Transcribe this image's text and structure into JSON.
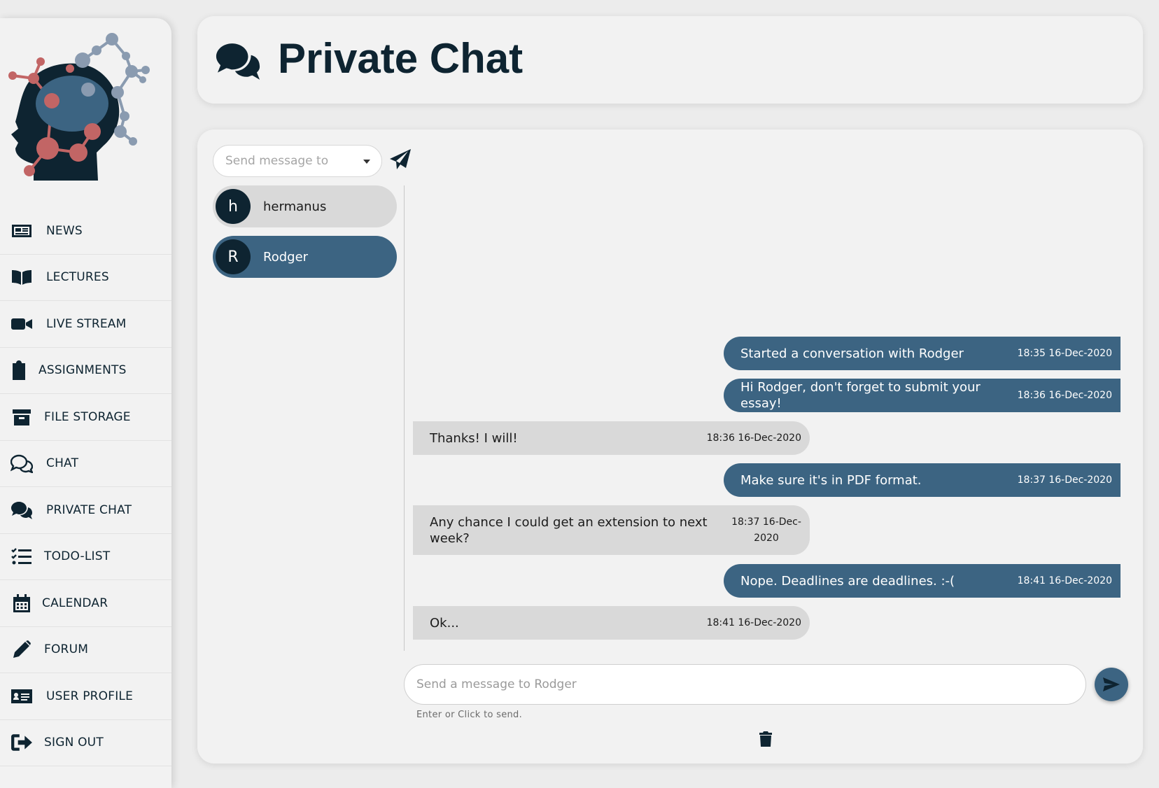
{
  "sidebar": {
    "items": [
      {
        "label": "NEWS",
        "icon": "newspaper-icon"
      },
      {
        "label": "LECTURES",
        "icon": "book-icon"
      },
      {
        "label": "LIVE STREAM",
        "icon": "video-camera-icon"
      },
      {
        "label": "ASSIGNMENTS",
        "icon": "clipboard-icon"
      },
      {
        "label": "FILE STORAGE",
        "icon": "archive-icon"
      },
      {
        "label": "CHAT",
        "icon": "comments-outline-icon"
      },
      {
        "label": "PRIVATE CHAT",
        "icon": "comments-icon"
      },
      {
        "label": "TODO-LIST",
        "icon": "tasks-icon"
      },
      {
        "label": "CALENDAR",
        "icon": "calendar-icon"
      },
      {
        "label": "FORUM",
        "icon": "pencil-icon"
      },
      {
        "label": "USER PROFILE",
        "icon": "id-card-icon"
      },
      {
        "label": "SIGN OUT",
        "icon": "sign-out-icon"
      }
    ]
  },
  "header": {
    "title": "Private Chat"
  },
  "recipient": {
    "placeholder": "Send message to"
  },
  "contacts": [
    {
      "initial": "h",
      "name": "hermanus",
      "active": false
    },
    {
      "initial": "R",
      "name": "Rodger",
      "active": true
    }
  ],
  "messages": [
    {
      "dir": "out",
      "text": "Started a conversation with Rodger",
      "time": "18:35 16-Dec-2020"
    },
    {
      "dir": "out",
      "text": "Hi Rodger, don't forget to submit your essay!",
      "time": "18:36 16-Dec-2020"
    },
    {
      "dir": "in",
      "text": "Thanks! I will!",
      "time": "18:36 16-Dec-2020"
    },
    {
      "dir": "out",
      "text": "Make sure it's in PDF format.",
      "time": "18:37 16-Dec-2020"
    },
    {
      "dir": "in",
      "text": "Any chance I could get an extension to next week?",
      "time": "18:37 16-Dec-2020"
    },
    {
      "dir": "out",
      "text": "Nope. Deadlines are deadlines. :-(",
      "time": "18:41 16-Dec-2020"
    },
    {
      "dir": "in",
      "text": "Ok...",
      "time": "18:41 16-Dec-2020"
    }
  ],
  "compose": {
    "placeholder": "Send a message to Rodger",
    "hint": "Enter or Click to send."
  },
  "colors": {
    "accent": "#3c6482",
    "dark": "#0e2431",
    "bubble_in": "#d9d9d9"
  }
}
